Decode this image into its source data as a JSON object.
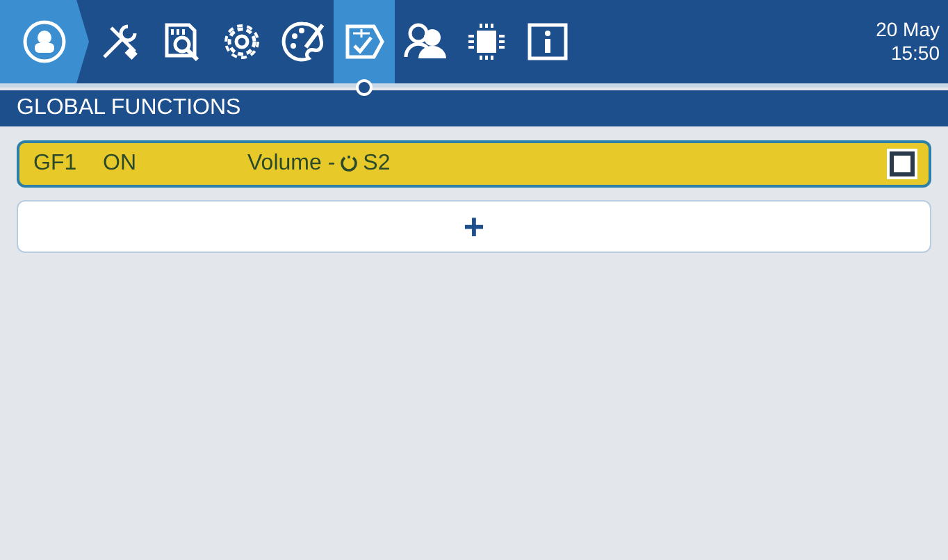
{
  "top_bar": {
    "tabs": [
      {
        "kind": "home",
        "selected": false
      },
      {
        "kind": "tools",
        "selected": false
      },
      {
        "kind": "sdcard",
        "selected": false
      },
      {
        "kind": "gear",
        "selected": false
      },
      {
        "kind": "palette",
        "selected": false
      },
      {
        "kind": "checklist",
        "selected": true
      },
      {
        "kind": "users",
        "selected": false
      },
      {
        "kind": "chip",
        "selected": false
      },
      {
        "kind": "info",
        "selected": false
      }
    ],
    "date": "20 May",
    "time": "15:50"
  },
  "page_title": "GLOBAL FUNCTIONS",
  "functions": [
    {
      "id": "GF1",
      "state": "ON",
      "action": "Volume -",
      "switch": "S2",
      "checked": false,
      "selected": true
    }
  ],
  "add_button": "+"
}
